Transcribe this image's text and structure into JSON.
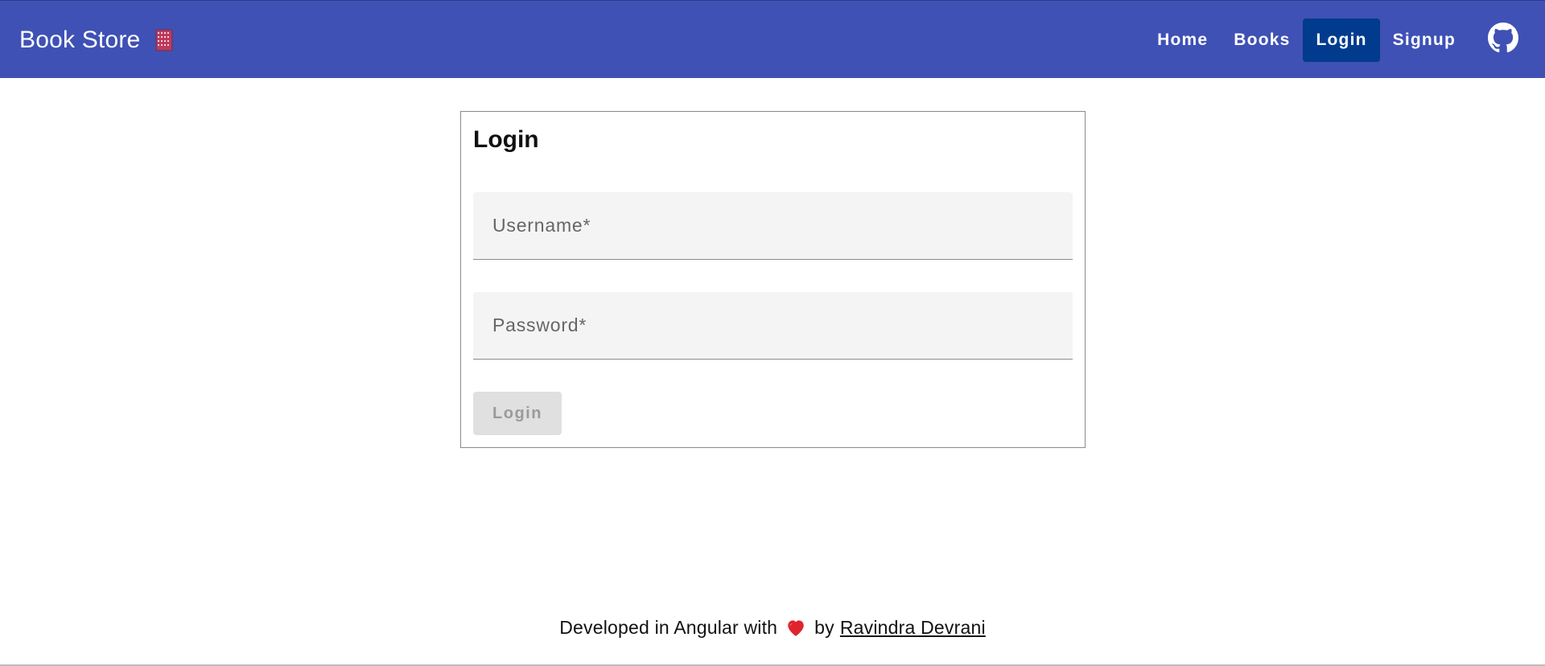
{
  "header": {
    "brand_title": "Book Store",
    "brand_icon": "books-icon",
    "nav": [
      {
        "label": "Home",
        "active": false
      },
      {
        "label": "Books",
        "active": false
      },
      {
        "label": "Login",
        "active": true
      },
      {
        "label": "Signup",
        "active": false
      }
    ],
    "github_icon": "github-icon"
  },
  "login_form": {
    "title": "Login",
    "username_placeholder": "Username*",
    "username_value": "",
    "password_placeholder": "Password*",
    "password_value": "",
    "submit_label": "Login",
    "submit_disabled": true
  },
  "footer": {
    "prefix": "Developed in Angular with",
    "heart_icon": "heart-icon",
    "by": "by",
    "author": "Ravindra Devrani"
  },
  "colors": {
    "primary": "#3f51b5",
    "active_nav": "#003b8e",
    "field_bg": "#f4f4f4",
    "disabled_button_bg": "#e0e0e0"
  }
}
